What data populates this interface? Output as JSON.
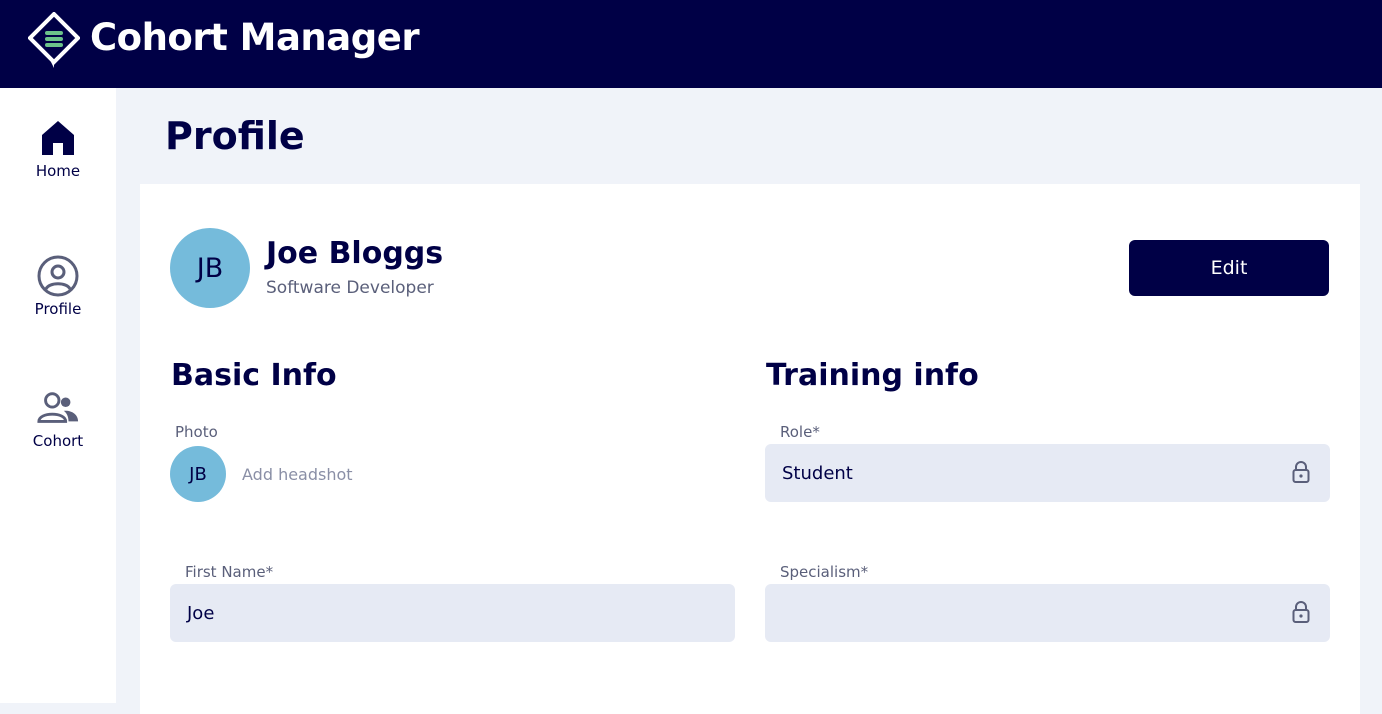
{
  "header": {
    "app_title": "Cohort Manager"
  },
  "sidebar": {
    "items": [
      {
        "label": "Home",
        "icon": "home-icon"
      },
      {
        "label": "Profile",
        "icon": "user-circle-icon"
      },
      {
        "label": "Cohort",
        "icon": "users-icon"
      }
    ]
  },
  "page": {
    "title": "Profile"
  },
  "profile": {
    "initials": "JB",
    "name": "Joe Bloggs",
    "job_title": "Software Developer",
    "edit_label": "Edit"
  },
  "basic_info": {
    "heading": "Basic Info",
    "photo_label": "Photo",
    "add_headshot": "Add headshot",
    "first_name_label": "First Name*",
    "first_name_value": "Joe"
  },
  "training_info": {
    "heading": "Training info",
    "role_label": "Role*",
    "role_value": "Student",
    "specialism_label": "Specialism*",
    "specialism_value": ""
  },
  "colors": {
    "navy": "#000046",
    "avatar": "#75bbdb",
    "field_bg": "#e6eaf4",
    "page_bg": "#f0f3f9",
    "logo_green": "#6cc38a"
  }
}
